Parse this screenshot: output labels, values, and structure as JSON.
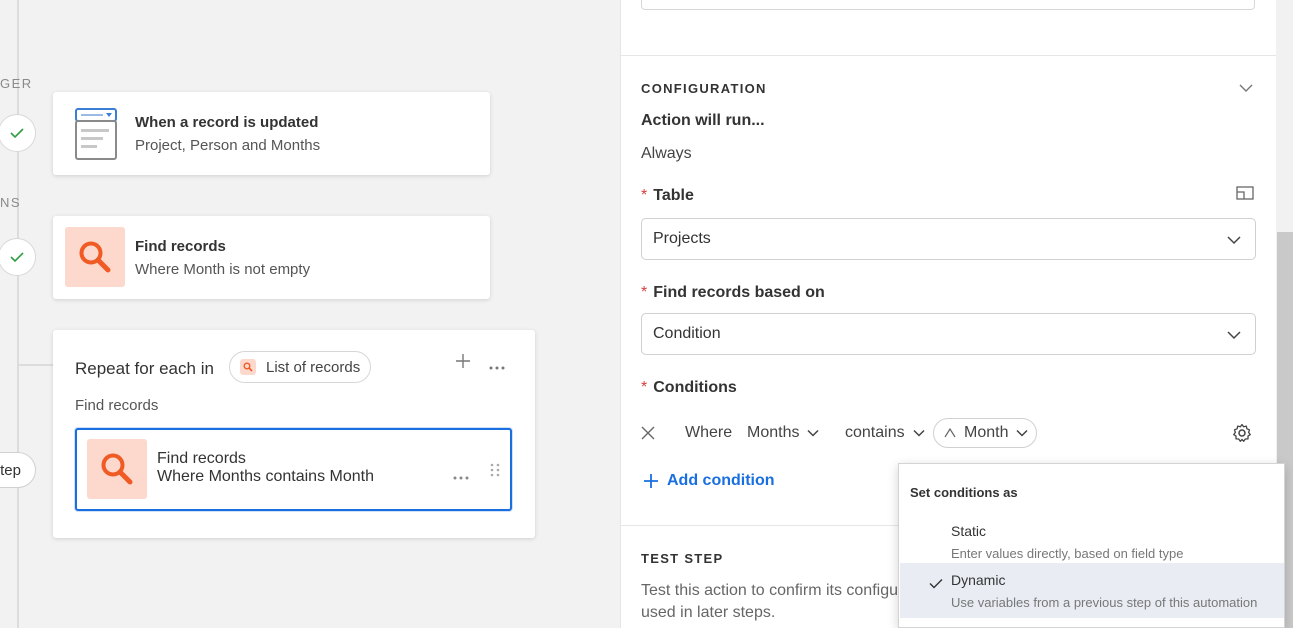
{
  "canvas": {
    "side_labels": {
      "trigger": "GER",
      "actions": "NS"
    },
    "step_pill": "tep",
    "trigger_card": {
      "title": "When a record is updated",
      "subtitle": "Project, Person and Months"
    },
    "find_card": {
      "title": "Find records",
      "subtitle": "Where Month is not empty"
    },
    "repeat": {
      "title": "Repeat for each in",
      "list_label": "List of records",
      "source": "Find records",
      "inner_card": {
        "title": "Find records",
        "subtitle": "Where Months contains Month"
      }
    }
  },
  "panel": {
    "configuration": {
      "header": "CONFIGURATION",
      "action_runs_label": "Action will run...",
      "action_runs_value": "Always",
      "table_label": "Table",
      "table_value": "Projects",
      "find_based_label": "Find records based on",
      "find_based_value": "Condition",
      "conditions_label": "Conditions",
      "condition": {
        "where": "Where",
        "field": "Months",
        "operator": "contains",
        "value": "Month"
      },
      "add_condition": "Add condition"
    },
    "test_step": {
      "header": "TEST STEP",
      "text_line1": "Test this action to confirm its configu",
      "text_line2": "used in later steps."
    }
  },
  "popup": {
    "title": "Set conditions as",
    "options": [
      {
        "name": "Static",
        "description": "Enter values directly, based on field type",
        "selected": false
      },
      {
        "name": "Dynamic",
        "description": "Use variables from a previous step of this automation",
        "selected": true
      }
    ]
  },
  "colors": {
    "accent": "#1a6fe0",
    "icon_bg": "#fdd9cd",
    "icon_fg": "#f05a24",
    "check": "#2f9e44",
    "required": "#d93f3f"
  }
}
